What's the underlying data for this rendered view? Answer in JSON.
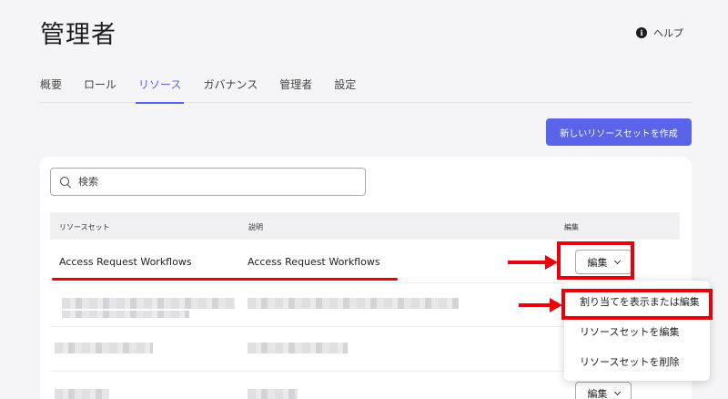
{
  "header": {
    "title": "管理者",
    "help_label": "ヘルプ",
    "help_icon": "info-icon"
  },
  "tabs": [
    {
      "label": "概要"
    },
    {
      "label": "ロール"
    },
    {
      "label": "リソース",
      "active": true
    },
    {
      "label": "ガバナンス"
    },
    {
      "label": "管理者"
    },
    {
      "label": "設定"
    }
  ],
  "create_button": {
    "label": "新しいリソースセットを作成"
  },
  "search": {
    "placeholder": "検索",
    "icon": "search-icon"
  },
  "table": {
    "columns": [
      "リソースセット",
      "説明",
      "編集"
    ],
    "rows": [
      {
        "name": "Access Request Workflows",
        "description": "Access Request Workflows",
        "edit_label": "編集"
      }
    ],
    "last_row_edit_label": "編集"
  },
  "dropdown": {
    "items": [
      "割り当てを表示または編集",
      "リソースセットを編集",
      "リソースセットを削除"
    ]
  },
  "colors": {
    "accent": "#5b63e8",
    "annotation": "#e8000b"
  }
}
